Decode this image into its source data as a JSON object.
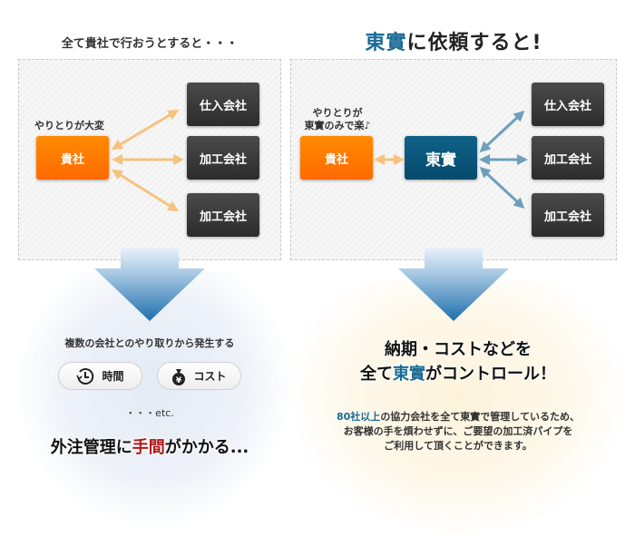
{
  "colors": {
    "accent_blue": "#1a6b95",
    "accent_red": "#b01818",
    "orange_box": "#ff7a00",
    "navy_box": "#0a5a80",
    "dark_box": "#3a3a3a",
    "orange_arrow": "#f7c27d",
    "blue_arrow": "#6d9fbd"
  },
  "left": {
    "heading": "全て貴社で行おうとすると・・・",
    "caption": "やりとりが大変",
    "client_box": "貴社",
    "partners": [
      "仕入会社",
      "加工会社",
      "加工会社"
    ],
    "issue_line": "複数の会社とのやり取りから発生する",
    "badges": [
      {
        "icon": "clock-icon",
        "label": "時間"
      },
      {
        "icon": "money-bag-icon",
        "label": "コスト"
      }
    ],
    "etc": "・・・etc.",
    "conclusion": {
      "pre": "外注管理に",
      "highlight": "手間",
      "post": "がかかる..."
    }
  },
  "right": {
    "heading": {
      "highlight": "東實",
      "rest": "に依頼すると!"
    },
    "caption_line1": "やりとりが",
    "caption_line2": "東實のみで楽♪",
    "client_box": "貴社",
    "hub_box": "東實",
    "partners": [
      "仕入会社",
      "加工会社",
      "加工会社"
    ],
    "control_line1": "納期・コストなどを",
    "control_line2": {
      "pre": "全て",
      "highlight": "東實",
      "post": "がコントロール！"
    },
    "desc_line1": {
      "highlight": "80社以上",
      "rest": "の協力会社を全て東實で管理しているため、"
    },
    "desc_line2": "お客様の手を煩わせずに、ご要望の加工済パイプを",
    "desc_line3": "ご利用して頂くことができます。"
  }
}
